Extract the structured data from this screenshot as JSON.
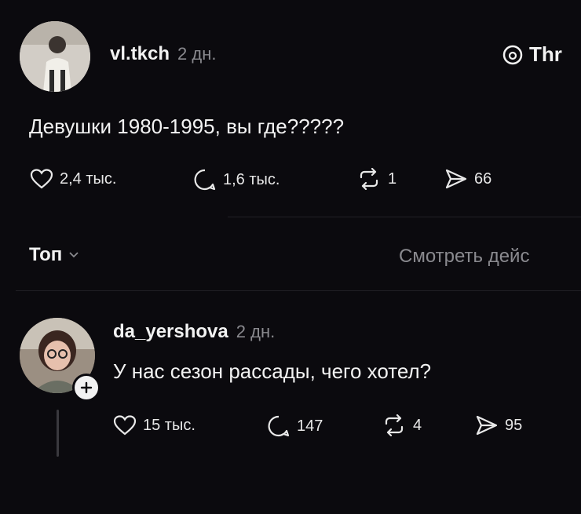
{
  "brand": {
    "label": "Thr",
    "icon": "threads-icon"
  },
  "post": {
    "username": "vl.tkch",
    "time": "2 дн.",
    "text": "Девушки 1980-1995, вы где?????",
    "likes": "2,4 тыс.",
    "replies": "1,6 тыс.",
    "reposts": "1",
    "shares": "66"
  },
  "sort": {
    "label": "Топ",
    "view_activity": "Смотреть дейс"
  },
  "reply": {
    "username": "da_yershova",
    "time": "2 дн.",
    "text": "У нас сезон рассады, чего хотел?",
    "likes": "15 тыс.",
    "replies": "147",
    "reposts": "4",
    "shares": "95"
  },
  "colors": {
    "background": "#0b0a0e",
    "text": "#f2f2f2",
    "muted": "#8a8a8f"
  }
}
